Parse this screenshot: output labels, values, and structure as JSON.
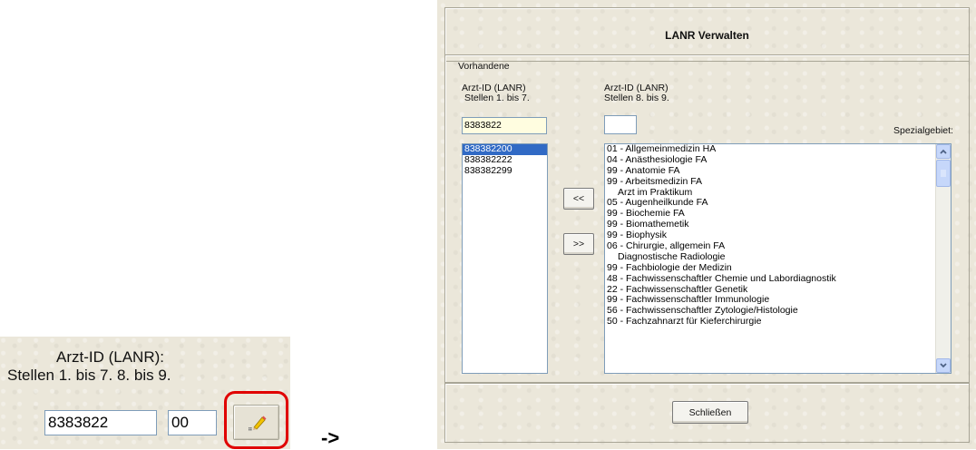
{
  "snippet": {
    "label_line1": "Arzt-ID (LANR):",
    "label_line2": "Stellen  1. bis 7.  8. bis 9.",
    "input1_value": "8383822",
    "input2_value": "00",
    "edit_icon": "pencil-icon"
  },
  "arrow": "->",
  "dialog": {
    "title": "LANR Verwalten",
    "group_label": "Vorhandene",
    "col1_label_line1": "Arzt-ID (LANR)",
    "col1_label_line2": "Stellen 1. bis 7.",
    "col2_label_line1": "Arzt-ID (LANR)",
    "col2_label_line2": "Stellen 8. bis 9.",
    "lanr_first_value": "8383822",
    "lanr_second_value": "",
    "specialty_label": "Spezialgebiet:",
    "lanr_list": [
      "838382200",
      "838382222",
      "838382299"
    ],
    "selected_index": 0,
    "move_left_label": "<<",
    "move_right_label": ">>",
    "specialty_list": [
      "01 - Allgemeinmedizin HA",
      "04 - Anästhesiologie FA",
      "99 - Anatomie FA",
      "99 - Arbeitsmedizin FA",
      "Arzt im Praktikum",
      "05 - Augenheilkunde FA",
      "99 - Biochemie FA",
      "99 - Biomathemetik",
      "99 - Biophysik",
      "06 - Chirurgie, allgemein FA",
      "Diagnostische Radiologie",
      "99 - Fachbiologie der Medizin",
      "48 - Fachwissenschaftler Chemie und Labordiagnostik",
      "22 - Fachwissenschaftler Genetik",
      "99 - Fachwissenschaftler Immunologie",
      "56 - Fachwissenschaftler Zytologie/Histologie",
      "50 - Fachzahnarzt für Kieferchirurgie"
    ],
    "close_label": "Schließen"
  }
}
